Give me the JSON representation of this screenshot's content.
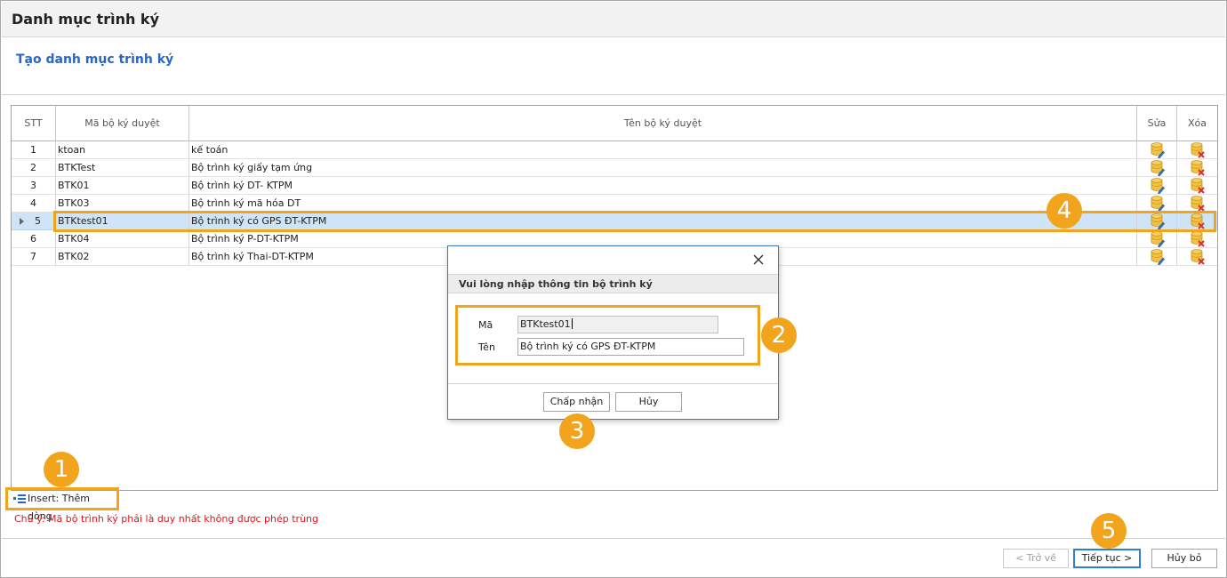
{
  "window": {
    "title": "Danh mục trình ký"
  },
  "page": {
    "subtitle": "Tạo danh mục trình ký"
  },
  "table": {
    "headers": {
      "stt": "STT",
      "ma": "Mã bộ ký duyệt",
      "ten": "Tên bộ ký duyệt",
      "sua": "Sửa",
      "xoa": "Xóa"
    },
    "rows": [
      {
        "stt": "1",
        "ma": "ktoan",
        "ten": "kế toán"
      },
      {
        "stt": "2",
        "ma": "BTKTest",
        "ten": "Bộ trình ký giấy tạm ứng"
      },
      {
        "stt": "3",
        "ma": "BTK01",
        "ten": "Bộ trình ký DT- KTPM"
      },
      {
        "stt": "4",
        "ma": "BTK03",
        "ten": "Bộ trình ký mã hóa DT"
      },
      {
        "stt": "5",
        "ma": "BTKtest01",
        "ten": "Bộ trình ký có GPS ĐT-KTPM"
      },
      {
        "stt": "6",
        "ma": "BTK04",
        "ten": "Bộ trình ký P-DT-KTPM"
      },
      {
        "stt": "7",
        "ma": "BTK02",
        "ten": "Bộ trình ký Thai-DT-KTPM"
      }
    ],
    "selected_row": "5"
  },
  "insert": {
    "label": "Insert: Thêm dòng"
  },
  "note": "Chú ý: Mã bộ trình ký phải là duy nhất không được phép trùng",
  "dialog": {
    "header": "Vui lòng nhập thông tin bộ trình ký",
    "ma_label": "Mã",
    "ma_value": "BTKtest01",
    "ten_label": "Tên",
    "ten_value": "Bộ trình ký có GPS ĐT-KTPM",
    "ok": "Chấp nhận",
    "cancel": "Hủy"
  },
  "footer": {
    "back": "< Trở về",
    "next": "Tiếp tục >",
    "cancel": "Hủy bỏ"
  },
  "badges": [
    "1",
    "2",
    "3",
    "4",
    "5"
  ],
  "colors": {
    "highlight": "#f2a51c",
    "title_blue": "#2a66c4",
    "note_red": "#e0161c",
    "selected_row": "#cfe4f6"
  },
  "icons": {
    "edit": "database-edit-icon",
    "delete": "database-delete-icon",
    "insert": "insert-row-icon",
    "close": "close-icon"
  }
}
